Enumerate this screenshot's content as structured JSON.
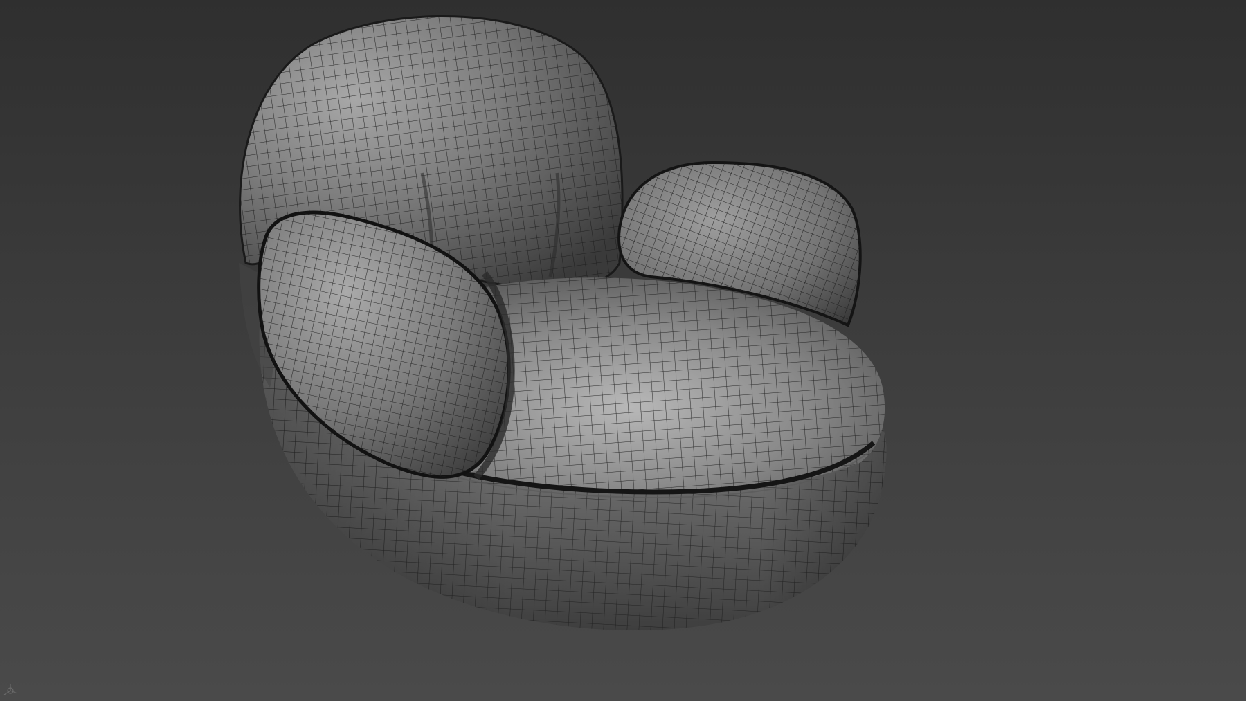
{
  "viewport": {
    "background_top": "#2f2f2f",
    "background_bottom": "#4a4a4a",
    "shading_mode": "wireframe-on-shaded",
    "object": "armchair-mesh",
    "mesh_base_color": "#7a7a7a",
    "mesh_highlight_color": "#b4b4b4",
    "mesh_shadow_color": "#2c2c2c",
    "wire_color": "#1c1c1c"
  },
  "gizmo": {
    "icon": "view-axis-icon"
  }
}
